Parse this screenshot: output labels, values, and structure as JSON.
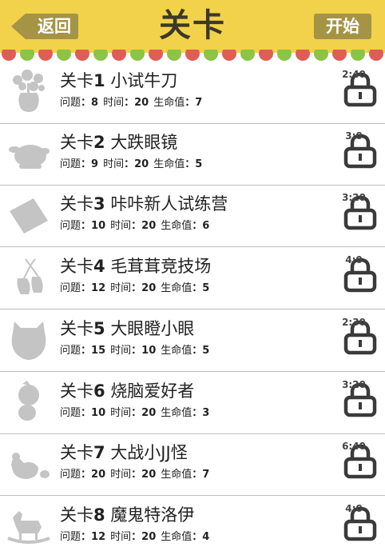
{
  "header": {
    "title": "关卡",
    "back_label": "返回",
    "start_label": "开始"
  },
  "stat_labels": {
    "questions": "问题",
    "time": "时间",
    "lives": "生命值"
  },
  "levels": [
    {
      "prefix": "关卡",
      "num": "1",
      "name": "小试牛刀",
      "questions": "8",
      "time": "20",
      "lives": "7",
      "limit": "2:40",
      "thumb": "flower-vase-icon"
    },
    {
      "prefix": "关卡",
      "num": "2",
      "name": "大跌眼镜",
      "questions": "9",
      "time": "20",
      "lives": "5",
      "limit": "3:0",
      "thumb": "roast-chicken-icon"
    },
    {
      "prefix": "关卡",
      "num": "3",
      "name": "咔咔新人试练营",
      "questions": "10",
      "time": "20",
      "lives": "6",
      "limit": "3:20",
      "thumb": "card-icon"
    },
    {
      "prefix": "关卡",
      "num": "4",
      "name": "毛茸茸竞技场",
      "questions": "12",
      "time": "20",
      "lives": "5",
      "limit": "4:0",
      "thumb": "mittens-icon"
    },
    {
      "prefix": "关卡",
      "num": "5",
      "name": "大眼瞪小眼",
      "questions": "15",
      "time": "10",
      "lives": "5",
      "limit": "2:30",
      "thumb": "owl-icon"
    },
    {
      "prefix": "关卡",
      "num": "6",
      "name": "烧脑爱好者",
      "questions": "10",
      "time": "20",
      "lives": "3",
      "limit": "3:20",
      "thumb": "chick-icon"
    },
    {
      "prefix": "关卡",
      "num": "7",
      "name": "大战小JJ怪",
      "questions": "20",
      "time": "20",
      "lives": "7",
      "limit": "6:40",
      "thumb": "hen-icon"
    },
    {
      "prefix": "关卡",
      "num": "8",
      "name": "魔鬼特洛伊",
      "questions": "12",
      "time": "20",
      "lives": "4",
      "limit": "4:0",
      "thumb": "rocking-horse-icon"
    }
  ],
  "colors": {
    "header": "#f2d24a",
    "button": "#a59446",
    "scallop_red": "#e05d56",
    "scallop_green": "#8cc443",
    "thumb_gray": "#c4c4c4",
    "lock": "#3a3a3a"
  }
}
